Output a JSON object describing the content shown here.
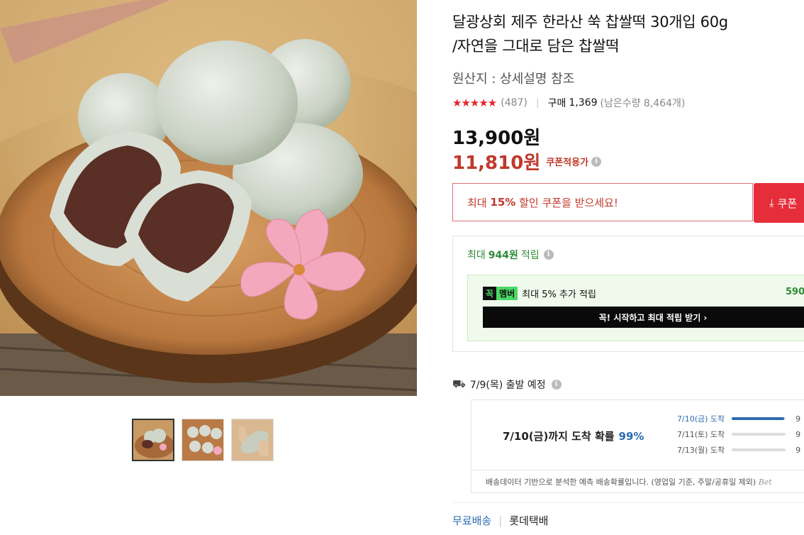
{
  "product": {
    "title_line1": "달광상회 제주 한라산 쑥 찹쌀떡 30개입 60g",
    "title_line2": "/자연을 그대로 담은 찹쌀떡",
    "origin": "원산지 : 상세설명 참조",
    "rating": 4.5,
    "stars_text": "★★★★★",
    "review_count": "(487)",
    "buy_label": "구매",
    "buy_count": "1,369",
    "stock_text": "(남은수량 8,464개)"
  },
  "price": {
    "original": "13,900원",
    "sale": "11,810원",
    "coupon_label": "쿠폰적용가"
  },
  "coupon": {
    "prefix": "최대",
    "percent": "15%",
    "suffix": "할인 쿠폰을 받으세요!",
    "button_label": "쿠폰"
  },
  "reward": {
    "prefix": "최대",
    "amount": "944원",
    "suffix": "적립",
    "member_badge_k": "꼭",
    "member_badge_m": "멤버",
    "member_text": "최대 5% 추가 적립",
    "member_amount": "590",
    "member_cta": "꼭! 시작하고 최대 적립 받기 ›"
  },
  "shipping": {
    "departure": "7/9(목) 출발 예정",
    "summary": "7/10(금)까지 도착 확률",
    "summary_pct": "99%",
    "distribution": [
      {
        "label": "7/10(금) 도착",
        "value": "9",
        "fill": 0.97
      },
      {
        "label": "7/11(토) 도착",
        "value": "9",
        "fill": 0.0
      },
      {
        "label": "7/13(월) 도착",
        "value": "9",
        "fill": 0.0
      }
    ],
    "note": "배송데이터 기반으로 분석한 예측 배송확률입니다. (영업일 기준, 주말/공휴일 제외)",
    "note_logo": "Bet",
    "free_shipping": "무료배송",
    "carrier": "롯데택배"
  },
  "colors": {
    "sale_red": "#c0392b",
    "coupon_red": "#e52e3a",
    "reward_green": "#2e8b3a",
    "info_blue": "#2b6cb0"
  },
  "icons": {
    "info": "info-circle-icon",
    "truck": "truck-icon",
    "download": "download-arrow-icon"
  }
}
